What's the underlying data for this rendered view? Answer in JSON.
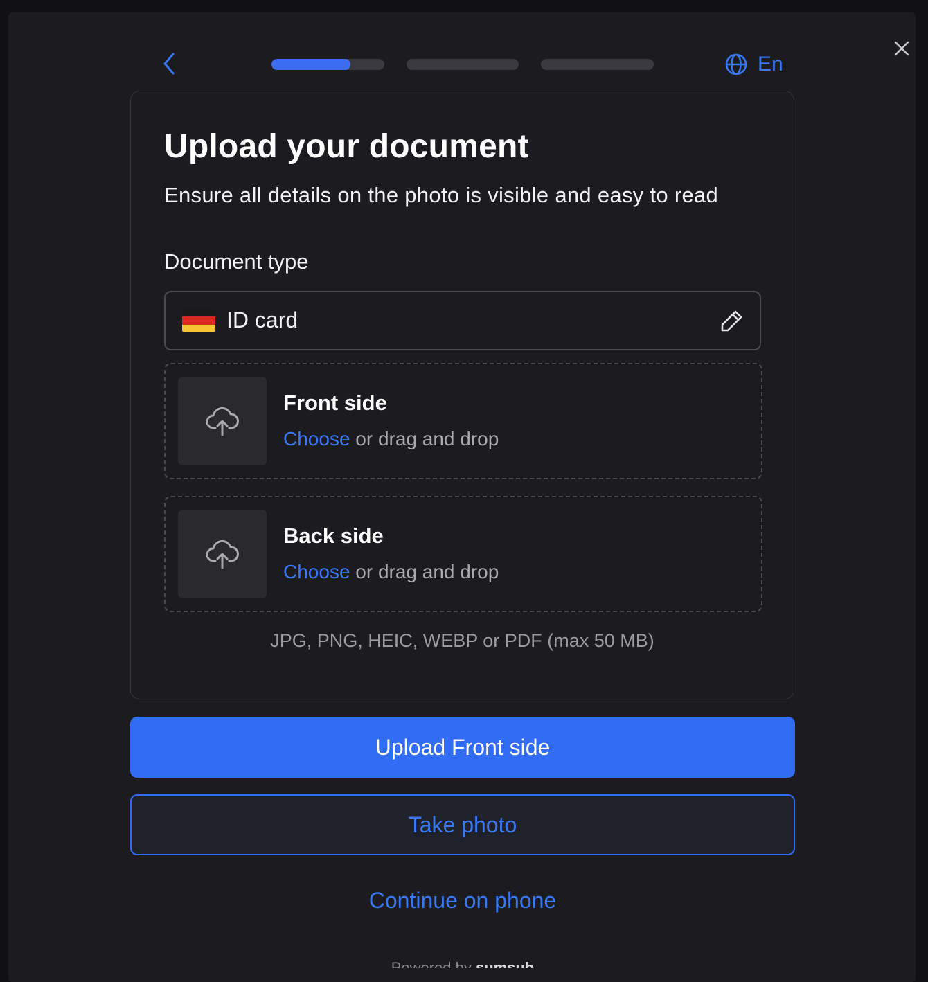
{
  "header": {
    "back_icon": "chevron-left-icon",
    "progress": [
      0.7,
      0,
      0
    ],
    "language": "En",
    "language_icon": "globe-icon",
    "close_icon": "close-icon"
  },
  "card": {
    "title": "Upload your document",
    "subtitle": "Ensure all details on the photo is visible and easy to read",
    "document_type_label": "Document type",
    "document_type_value": "ID card",
    "document_flag": "germany-flag",
    "dropzones": [
      {
        "title": "Front side",
        "choose": "Choose",
        "rest": " or drag and drop"
      },
      {
        "title": "Back side",
        "choose": "Choose",
        "rest": " or drag and drop"
      }
    ],
    "formats": "JPG, PNG, HEIC, WEBP or PDF (max 50 MB)"
  },
  "actions": {
    "primary": "Upload Front side",
    "secondary": "Take photo",
    "link": "Continue on phone"
  },
  "footer": {
    "powered_by": "Powered by",
    "brand": "sumsub"
  },
  "colors": {
    "accent": "#316cf4",
    "link": "#3a78f2",
    "background": "#1c1c20"
  }
}
